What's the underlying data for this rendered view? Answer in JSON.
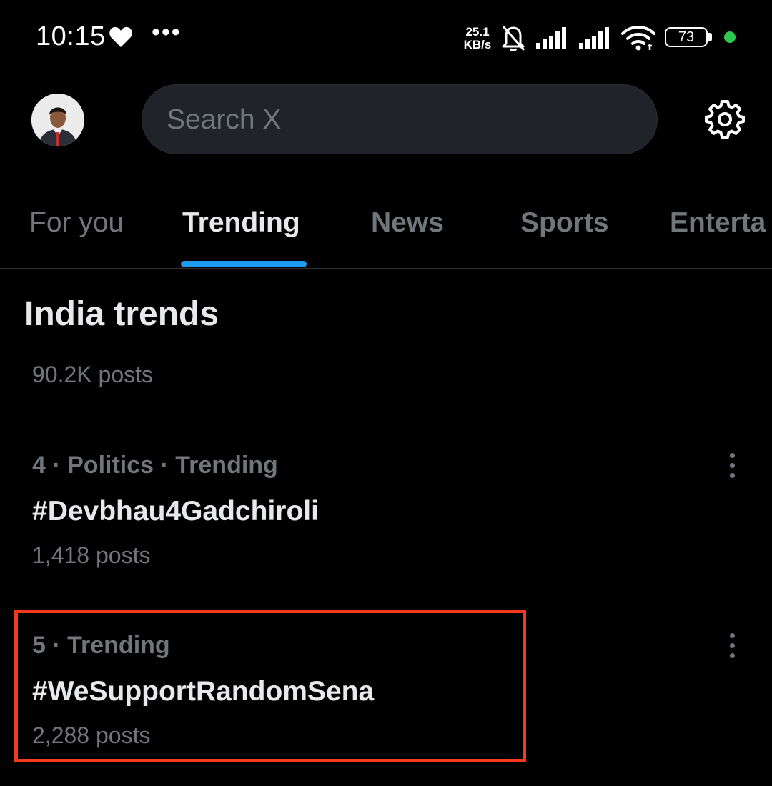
{
  "status_bar": {
    "time": "10:15",
    "speed_value": "25.1",
    "speed_unit": "KB/s",
    "battery": "73",
    "icons": [
      "heart-icon",
      "more-dots-icon",
      "bell-off-icon",
      "signal-icon",
      "signal-icon",
      "wifi-icon",
      "battery-icon",
      "dot-indicator"
    ],
    "indicator_color": "#2dc84d"
  },
  "header": {
    "search_placeholder": "Search X",
    "avatar": "avatar",
    "settings_icon": "gear-icon"
  },
  "tabs": [
    {
      "label": "For you",
      "active": false
    },
    {
      "label": "Trending",
      "active": true
    },
    {
      "label": "News",
      "active": false
    },
    {
      "label": "Sports",
      "active": false
    },
    {
      "label": "Enterta",
      "active": false
    }
  ],
  "accent_color": "#1d9bf0",
  "section": {
    "title": "India trends",
    "partial_posts": "90.2K posts"
  },
  "trends": [
    {
      "meta": "4 · Politics · Trending",
      "name": "#Devbhau4Gadchiroli",
      "posts": "1,418 posts"
    },
    {
      "meta": "5 · Trending",
      "name": "#WeSupportRandomSena",
      "posts": "2,288 posts",
      "highlighted": true
    }
  ],
  "highlight_color": "#f4391c"
}
